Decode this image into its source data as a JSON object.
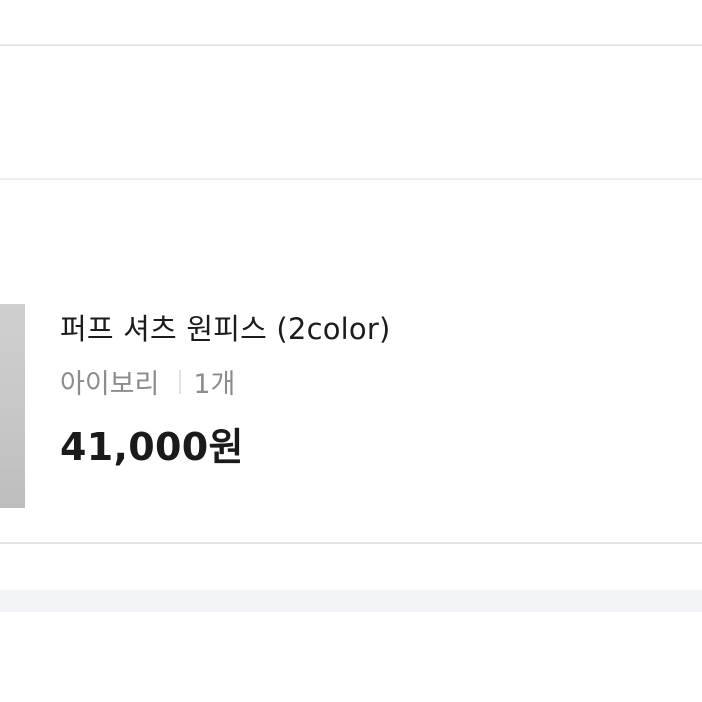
{
  "product": {
    "name": "퍼프 셔츠 원피스 (2color)",
    "option": "아이보리",
    "quantity": "1개",
    "price": "41,000원"
  }
}
